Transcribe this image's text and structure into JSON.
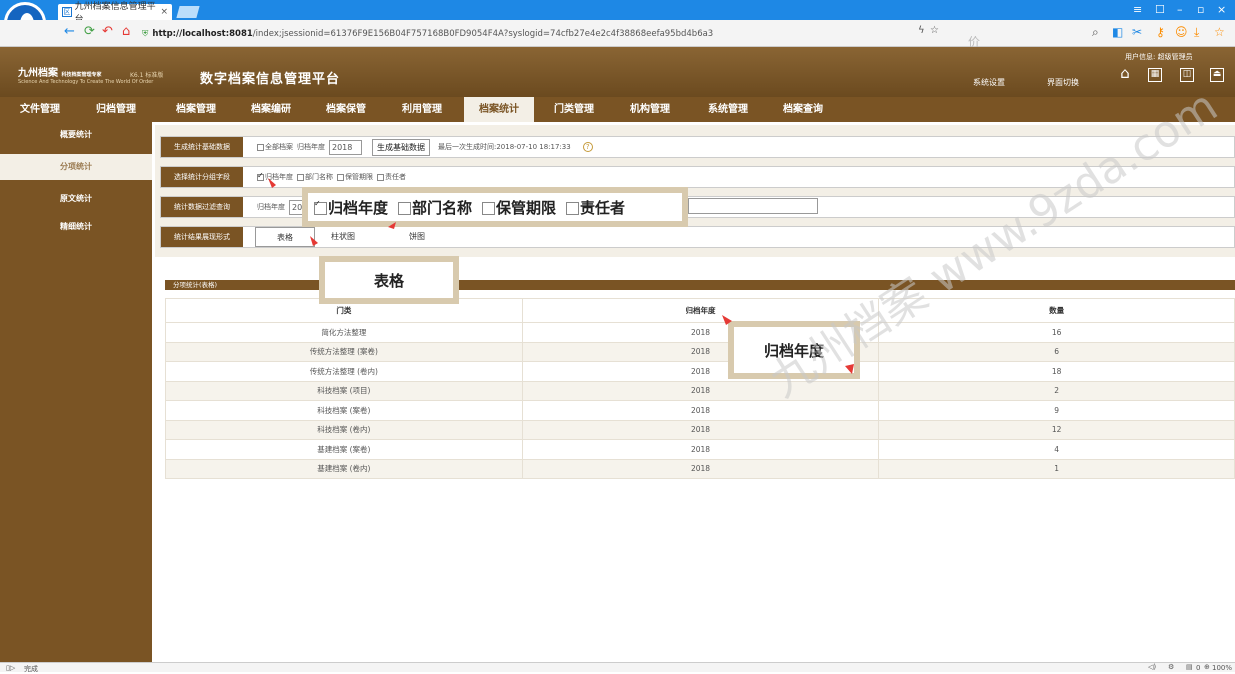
{
  "browser": {
    "tab_title": "九州档案信息管理平台",
    "url_host": "http://localhost:8081",
    "url_path": "/index;jsessionid=61376F9E156B04F757168B0FD9054F4A?syslogid=74cfb27e4e2c4f38868eefa95bd4b6a3",
    "search_placeholder": "价值千万王米被都",
    "status_left": "完成",
    "zoom": "100%",
    "status_badge": "0"
  },
  "header": {
    "brand_name": "九州档案",
    "brand_tagline": "科技档案管理专家",
    "brand_slogan": "Science And Technology To Create The World Of Order",
    "version": "K6.1 标准版",
    "system_title": "数字档案信息管理平台",
    "user_info": "用户信息: 超级管理员",
    "link_settings": "系统设置",
    "link_switch": "界面切换"
  },
  "nav": {
    "items": [
      "文件管理",
      "归档管理",
      "档案管理",
      "档案编研",
      "档案保管",
      "利用管理",
      "档案统计",
      "门类管理",
      "机构管理",
      "系统管理",
      "档案查询"
    ],
    "active_index": 6
  },
  "sidebar": {
    "items": [
      "概要统计",
      "分项统计",
      "原文统计",
      "精细统计"
    ],
    "active_index": 1
  },
  "filters": {
    "row1": {
      "label": "生成统计基础数据",
      "all_archives": "全部档案",
      "year_label": "归档年度",
      "year_value": "2018",
      "button": "生成基础数据",
      "last_time": "最后一次生成时间:2018-07-10 18:17:33"
    },
    "row2": {
      "label": "选择统计分组字段",
      "options": [
        {
          "label": "归档年度",
          "checked": true
        },
        {
          "label": "部门名称",
          "checked": false
        },
        {
          "label": "保管期限",
          "checked": false
        },
        {
          "label": "责任者",
          "checked": false
        }
      ]
    },
    "row3": {
      "label": "统计数据过滤查询",
      "field_label": "归档年度",
      "field_value": "201"
    },
    "row4": {
      "label": "统计结果展现形式",
      "options": [
        "表格",
        "柱状图",
        "饼图"
      ],
      "active": "表格"
    }
  },
  "callouts": {
    "fields": [
      "归档年度",
      "部门名称",
      "保管期限",
      "责任者"
    ],
    "table": "表格",
    "year": "归档年度"
  },
  "table": {
    "title": "分项统计(表格)",
    "headers": [
      "门类",
      "归档年度",
      "数量"
    ],
    "rows": [
      [
        "简化方法整理",
        "2018",
        "16"
      ],
      [
        "传统方法整理 (案卷)",
        "2018",
        "6"
      ],
      [
        "传统方法整理 (卷内)",
        "2018",
        "18"
      ],
      [
        "科技档案 (项目)",
        "2018",
        "2"
      ],
      [
        "科技档案 (案卷)",
        "2018",
        "9"
      ],
      [
        "科技档案 (卷内)",
        "2018",
        "12"
      ],
      [
        "基建档案 (案卷)",
        "2018",
        "4"
      ],
      [
        "基建档案 (卷内)",
        "2018",
        "1"
      ]
    ]
  },
  "watermark": "九州档案 www.9zda.com",
  "colors": {
    "brown_dark": "#7a5424",
    "brown_header": "#8a6534",
    "panel_bg": "#f3efe6",
    "browser_blue": "#1e88e5",
    "arrow_red": "#e53935"
  }
}
